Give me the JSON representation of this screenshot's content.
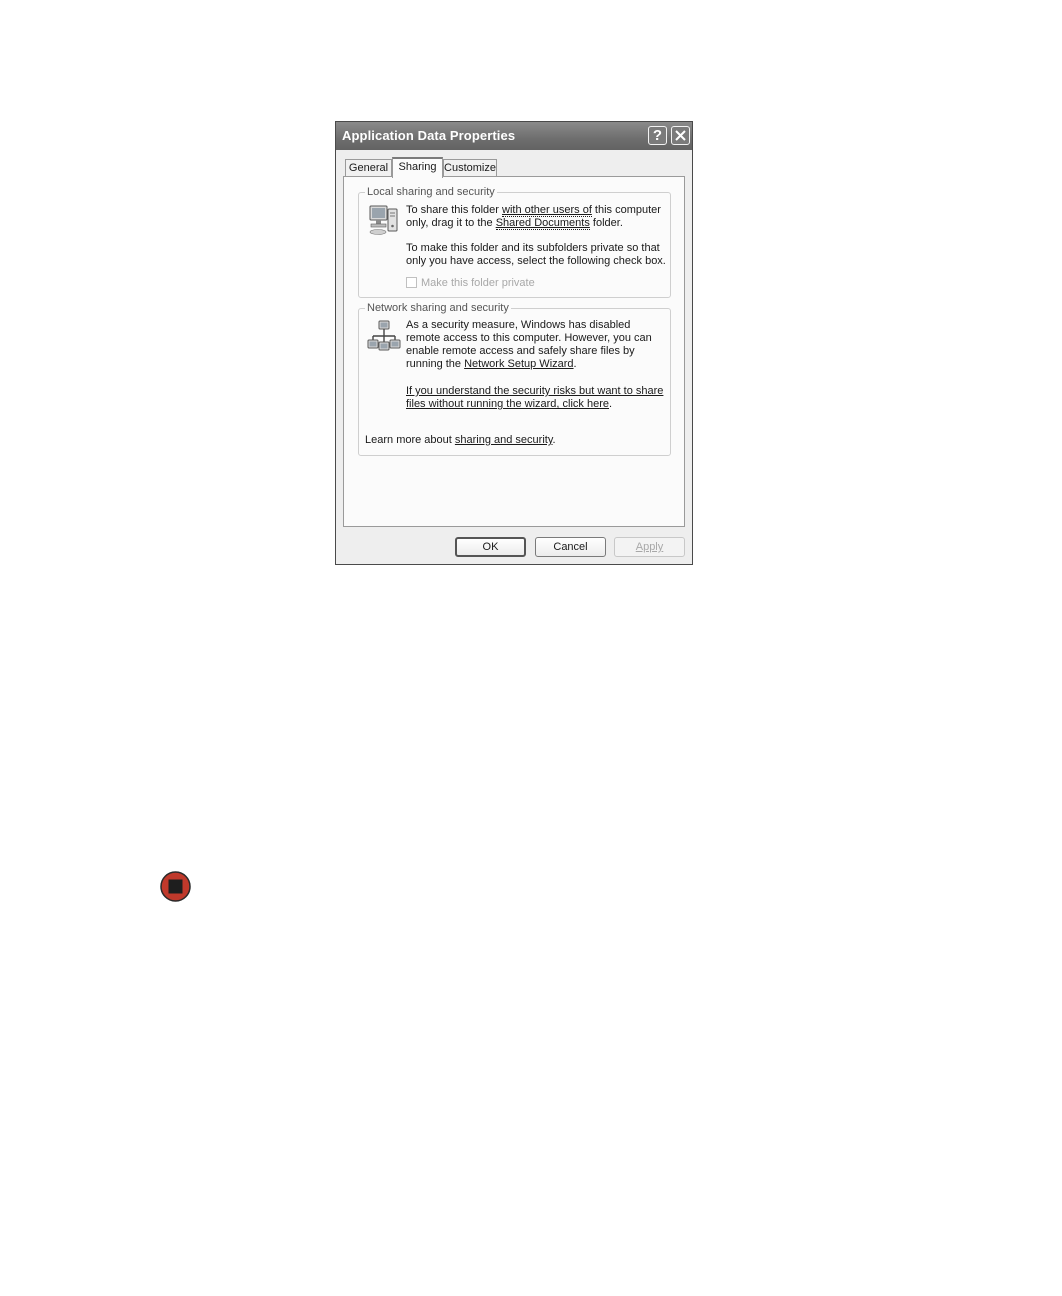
{
  "window": {
    "title": "Application Data Properties",
    "help_glyph": "?",
    "close_icon": "close-icon"
  },
  "tabs": [
    {
      "label": "General",
      "active": false
    },
    {
      "label": "Sharing",
      "active": true
    },
    {
      "label": "Customize",
      "active": false
    }
  ],
  "local_sharing": {
    "legend": "Local sharing and security",
    "icon": "computer-icon",
    "para1_prefix": "To share this folder ",
    "para1_link1": "with other users of",
    "para1_middle": " this computer only, drag it to the ",
    "para1_link2": "Shared Documents",
    "para1_suffix": " folder.",
    "para2": "To make this folder and its subfolders private so that only you have access, select the following check box.",
    "checkbox_label": "Make this folder private",
    "checkbox_checked": false,
    "checkbox_enabled": false
  },
  "network_sharing": {
    "legend": "Network sharing and security",
    "icon": "network-icon",
    "para1": "As a security measure, Windows has disabled remote access to this computer. However, you can enable remote access and safely share files by running the ",
    "wizard_link": "Network Setup Wizard",
    "wizard_suffix": ".",
    "risk_link": "If you understand the security risks but want to share files without running the wizard, click here",
    "risk_suffix": ".",
    "learn_more_prefix": "Learn more about ",
    "learn_more_link": "sharing and security",
    "learn_more_suffix": "."
  },
  "buttons": {
    "ok": "OK",
    "cancel": "Cancel",
    "apply": "Apply",
    "apply_enabled": false
  },
  "page": {
    "stop_icon": "stop-icon",
    "stop_icon_color": "#c0392b"
  }
}
